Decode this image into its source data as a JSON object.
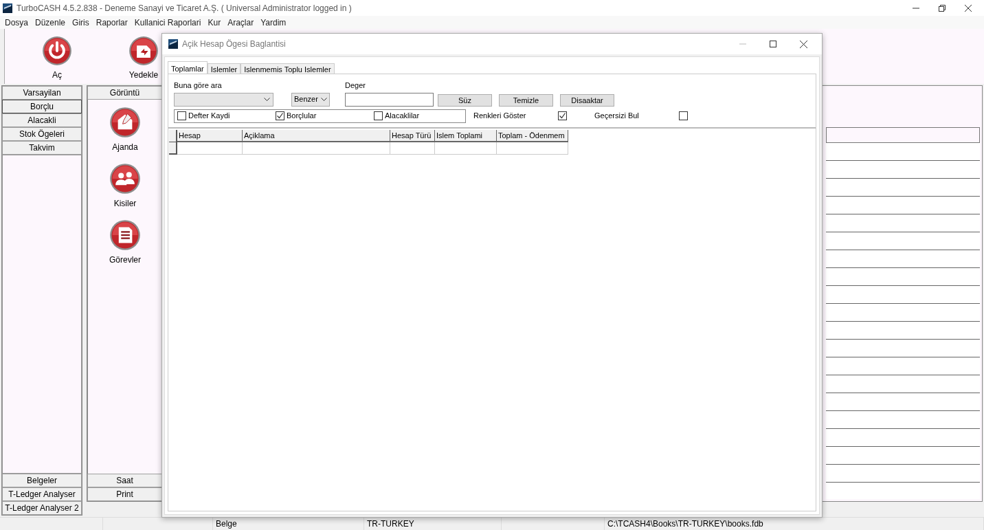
{
  "window": {
    "title": "TurboCASH 4.5.2.838  - Deneme Sanayi ve Ticaret A.Ş. ( Universal Administrator logged in )"
  },
  "menu": [
    "Dosya",
    "Düzenle",
    "Giris",
    "Raporlar",
    "Kullanici Raporlari",
    "Kur",
    "Araçlar",
    "Yardim"
  ],
  "toolbar": [
    {
      "label": "Aç",
      "kind": "power"
    },
    {
      "label": "Yedekle",
      "kind": "backup"
    }
  ],
  "left_bar": {
    "top_tabs": [
      {
        "label": "Varsayilan",
        "selected": false
      },
      {
        "label": "Borçlu",
        "selected": true
      },
      {
        "label": "Alacakli",
        "selected": false
      },
      {
        "label": "Stok Ögeleri",
        "selected": false
      },
      {
        "label": "Takvim",
        "selected": false
      }
    ],
    "bottom_tabs": [
      "Belgeler",
      "T-Ledger Analyser",
      "T-Ledger Analyser 2"
    ]
  },
  "view_panel": {
    "header": "Görüntü",
    "items": [
      {
        "label": "Ajanda",
        "kind": "notes"
      },
      {
        "label": "Kisiler",
        "kind": "people"
      },
      {
        "label": "Görevler",
        "kind": "document"
      }
    ],
    "bottom_tabs": [
      "Saat",
      "Print"
    ]
  },
  "dialog": {
    "title": "Açik Hesap Ögesi Baglantisi",
    "tabs": [
      {
        "label": "Toplamlar",
        "selected": true
      },
      {
        "label": "Islemler",
        "selected": false
      },
      {
        "label": "Islenmemis Toplu Islemler",
        "selected": false
      }
    ],
    "search_by": {
      "label": "Buna göre ara"
    },
    "match": {
      "value": "Benzer"
    },
    "value_field": {
      "label": "Deger"
    },
    "buttons": [
      "Süz",
      "Temizle",
      "Disaaktar"
    ],
    "filters": [
      {
        "label": "Defter Kaydi",
        "checked": false
      },
      {
        "label": "Borçlular",
        "checked": true
      },
      {
        "label": "Alacaklilar",
        "checked": false
      }
    ],
    "options": [
      {
        "label": "Renkleri Göster",
        "checked": true
      },
      {
        "label": "Geçersizi Bul",
        "checked": false
      }
    ],
    "table": {
      "columns": [
        "Hesap",
        "Açiklama",
        "Hesap Türü",
        "Islem Toplami",
        "Toplam - Ödenmem"
      ]
    }
  },
  "status_bar": [
    "Belge",
    "TR-TURKEY",
    "C:\\TCASH4\\Books\\TR-TURKEY\\books.fdb"
  ]
}
